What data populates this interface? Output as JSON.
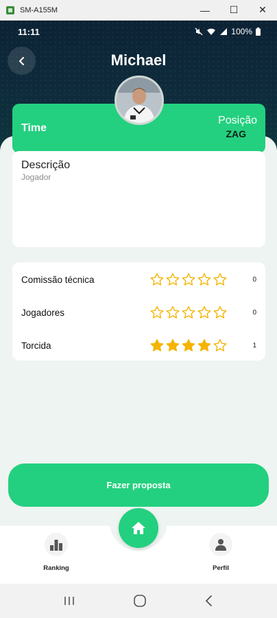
{
  "window": {
    "title": "SM-A155M",
    "minimize": "—",
    "maximize": "☐",
    "close": "✕"
  },
  "status_bar": {
    "time": "11:11",
    "battery": "100%"
  },
  "header": {
    "title": "Michael"
  },
  "team_card": {
    "time_label": "Time",
    "position_label": "Posição",
    "position_value": "ZAG"
  },
  "description": {
    "title": "Descrição",
    "subtitle": "Jogador"
  },
  "ratings": [
    {
      "label": "Comissão técnica",
      "stars": 0,
      "max": 5,
      "count": "0"
    },
    {
      "label": "Jogadores",
      "stars": 0,
      "max": 5,
      "count": "0"
    },
    {
      "label": "Torcida",
      "stars": 4,
      "max": 5,
      "count": "1"
    }
  ],
  "propose_button": {
    "label": "Fazer proposta"
  },
  "bottom_nav": {
    "ranking_label": "Ranking",
    "profile_label": "Perfil"
  },
  "colors": {
    "accent": "#23d07f",
    "star": "#f5b400",
    "header": "#0c2235"
  }
}
